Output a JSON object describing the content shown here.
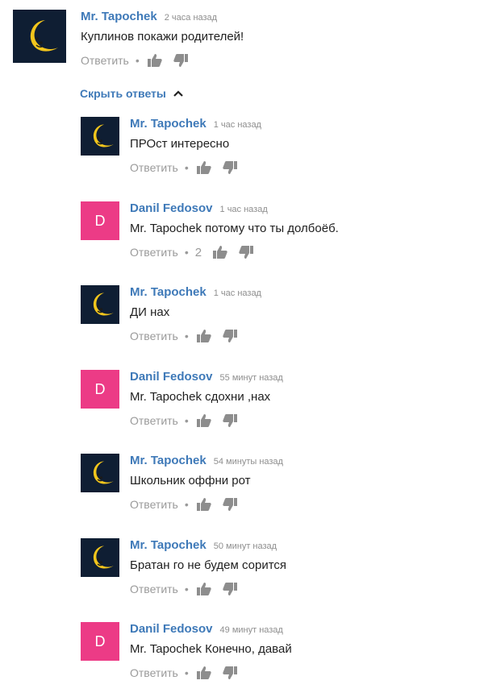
{
  "icons": {
    "like": "thumbs-up-icon",
    "dislike": "thumbs-down-icon",
    "chevron": "chevron-up-icon",
    "moon_avatar": "crescent-moon-avatar"
  },
  "colors": {
    "author": "#3e79b8",
    "avatar_dark": "#0f1e33",
    "avatar_pink": "#ec3b86",
    "moon": "#f2c51c",
    "muted": "#9a9a9a"
  },
  "top_comment": {
    "author": "Mr. Tapochek",
    "time": "2 часа назад",
    "text": "Куплинов покажи родителей!",
    "reply_label": "Ответить",
    "dot": "•",
    "avatar_type": "moon"
  },
  "hide_replies_label": "Скрыть ответы",
  "replies": [
    {
      "author": "Mr. Tapochek",
      "time": "1 час назад",
      "text": "ПРОст интересно",
      "reply_label": "Ответить",
      "dot": "•",
      "likes": "",
      "avatar_type": "moon"
    },
    {
      "author": "Danil Fedosov",
      "time": "1 час назад",
      "text": "Mr. Tapochek потому что ты долбоёб.",
      "reply_label": "Ответить",
      "dot": "•",
      "likes": "2",
      "avatar_type": "letter",
      "avatar_letter": "D"
    },
    {
      "author": "Mr. Tapochek",
      "time": "1 час назад",
      "text": "ДИ нах",
      "reply_label": "Ответить",
      "dot": "•",
      "likes": "",
      "avatar_type": "moon"
    },
    {
      "author": "Danil Fedosov",
      "time": "55 минут назад",
      "text": "Mr. Tapochek сдохни ,нах",
      "reply_label": "Ответить",
      "dot": "•",
      "likes": "",
      "avatar_type": "letter",
      "avatar_letter": "D"
    },
    {
      "author": "Mr. Tapochek",
      "time": "54 минуты назад",
      "text": "Школьник оффни рот",
      "reply_label": "Ответить",
      "dot": "•",
      "likes": "",
      "avatar_type": "moon"
    },
    {
      "author": "Mr. Tapochek",
      "time": "50 минут назад",
      "text": "Братан го не будем сорится",
      "reply_label": "Ответить",
      "dot": "•",
      "likes": "",
      "avatar_type": "moon"
    },
    {
      "author": "Danil Fedosov",
      "time": "49 минут назад",
      "text": "Mr. Tapochek Конечно, давай",
      "reply_label": "Ответить",
      "dot": "•",
      "likes": "",
      "avatar_type": "letter",
      "avatar_letter": "D"
    }
  ]
}
